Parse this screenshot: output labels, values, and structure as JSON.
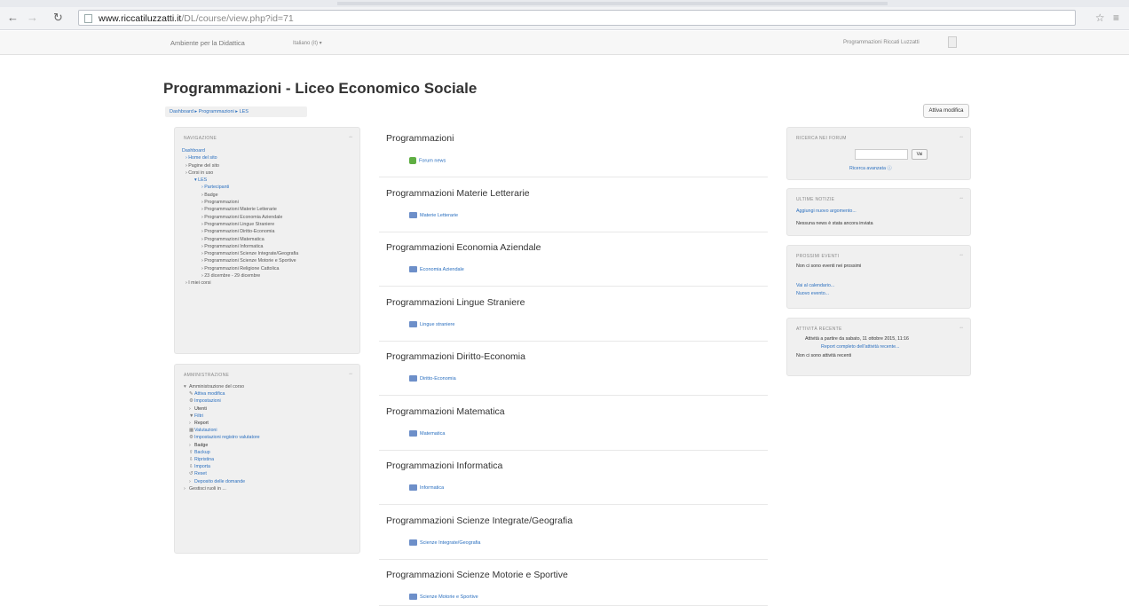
{
  "browser": {
    "url_host": "www.riccatiluzzatti.it",
    "url_path": "/DL/course/view.php?id=71"
  },
  "topbar": {
    "brand": "Ambiente per la Didattica",
    "language": "Italiano (it) ▾",
    "user": "Programmazioni Riccati Luzzatti"
  },
  "header": {
    "title": "Programmazioni - Liceo Economico Sociale",
    "breadcrumb": "Dashboard ▸ Programmazioni ▸ LES",
    "edit_button": "Attiva modifica"
  },
  "navigation": {
    "title": "Navigazione",
    "items": [
      {
        "label": "Dashboard",
        "level": 0,
        "link": true
      },
      {
        "label": "› Home del sito",
        "level": 1,
        "link": true
      },
      {
        "label": "› Pagine del sito",
        "level": 1,
        "link": false
      },
      {
        "label": "› Corsi in uso",
        "level": 1,
        "link": false
      },
      {
        "label": "▾ LES",
        "level": 2,
        "link": true
      },
      {
        "label": "› Partecipanti",
        "level": 3,
        "link": true
      },
      {
        "label": "› Badge",
        "level": 3,
        "link": false
      },
      {
        "label": "› Programmazioni",
        "level": 3,
        "link": false
      },
      {
        "label": "› Programmazioni Materie Letterarie",
        "level": 3,
        "link": false
      },
      {
        "label": "› Programmazioni Economia Aziendale",
        "level": 3,
        "link": false
      },
      {
        "label": "› Programmazioni Lingue Straniere",
        "level": 3,
        "link": false
      },
      {
        "label": "› Programmazioni Diritto-Economia",
        "level": 3,
        "link": false
      },
      {
        "label": "› Programmazioni Matematica",
        "level": 3,
        "link": false
      },
      {
        "label": "› Programmazioni Informatica",
        "level": 3,
        "link": false
      },
      {
        "label": "› Programmazioni Scienze Integrate/Geografia",
        "level": 3,
        "link": false
      },
      {
        "label": "› Programmazioni Scienze Motorie e Sportive",
        "level": 3,
        "link": false
      },
      {
        "label": "› Programmazioni Religione Cattolica",
        "level": 3,
        "link": false
      },
      {
        "label": "› 23 dicembre - 29 dicembre",
        "level": 3,
        "link": false
      },
      {
        "label": "› I miei corsi",
        "level": 1,
        "link": false
      }
    ]
  },
  "administration": {
    "title": "Amministrazione",
    "items": [
      {
        "icon": "▾",
        "label": "Amministrazione del corso",
        "level": 1,
        "link": false
      },
      {
        "icon": "✎",
        "label": "Attiva modifica",
        "level": 2,
        "link": true
      },
      {
        "icon": "⚙",
        "label": "Impostazioni",
        "level": 2,
        "link": true
      },
      {
        "icon": "›",
        "label": "Utenti",
        "level": 2,
        "link": false
      },
      {
        "icon": "▼",
        "label": "Filtri",
        "level": 2,
        "link": true
      },
      {
        "icon": "›",
        "label": "Report",
        "level": 2,
        "link": false
      },
      {
        "icon": "▦",
        "label": "Valutazioni",
        "level": 2,
        "link": true
      },
      {
        "icon": "⚙",
        "label": "Impostazioni registro valutatore",
        "level": 2,
        "link": true
      },
      {
        "icon": "›",
        "label": "Badge",
        "level": 2,
        "link": false
      },
      {
        "icon": "⇧",
        "label": "Backup",
        "level": 2,
        "link": true
      },
      {
        "icon": "⇩",
        "label": "Ripristina",
        "level": 2,
        "link": true
      },
      {
        "icon": "⇩",
        "label": "Importa",
        "level": 2,
        "link": true
      },
      {
        "icon": "↺",
        "label": "Reset",
        "level": 2,
        "link": true
      },
      {
        "icon": "›",
        "label": "Deposito delle domande",
        "level": 2,
        "link": true
      },
      {
        "icon": "›",
        "label": "Gestisci ruoli in ...",
        "level": 1,
        "link": false
      }
    ]
  },
  "sections": [
    {
      "title": "Programmazioni",
      "activity": "Forum news",
      "icon": "forum"
    },
    {
      "title": "Programmazioni Materie Letterarie",
      "activity": "Materie Letterarie",
      "icon": "folder"
    },
    {
      "title": "Programmazioni Economia Aziendale",
      "activity": "Economia Aziendale",
      "icon": "folder"
    },
    {
      "title": "Programmazioni Lingue Straniere",
      "activity": "Lingue straniere",
      "icon": "folder"
    },
    {
      "title": "Programmazioni Diritto-Economia",
      "activity": "Diritto-Economia",
      "icon": "folder"
    },
    {
      "title": "Programmazioni Matematica",
      "activity": "Matematica",
      "icon": "folder"
    },
    {
      "title": "Programmazioni Informatica",
      "activity": "Informatica",
      "icon": "folder"
    },
    {
      "title": "Programmazioni Scienze Integrate/Geografia",
      "activity": "Scienze Integrate/Geografia",
      "icon": "folder"
    },
    {
      "title": "Programmazioni Scienze Motorie e Sportive",
      "activity": "Scienze Motorie e Sportive",
      "icon": "folder"
    }
  ],
  "forum_search": {
    "title": "Ricerca nei forum",
    "go": "Vai",
    "advanced": "Ricerca avanzata ⓘ"
  },
  "latest_news": {
    "title": "Ultime notizie",
    "add_link": "Aggiungi nuovo argomento...",
    "empty_text": "Nessuna news è stata ancora inviata"
  },
  "upcoming_events": {
    "title": "Prossimi eventi",
    "empty_text": "Non ci sono eventi nei prossimi",
    "calendar_link": "Vai al calendario...",
    "new_event_link": "Nuovo evento..."
  },
  "recent_activity": {
    "title": "Attività recente",
    "since": "Attività a partire da sabato, 11 ottobre 2015, 11:16",
    "full_report": "Report completo dell'attività recente...",
    "empty_text": "Non ci sono attività recenti"
  }
}
